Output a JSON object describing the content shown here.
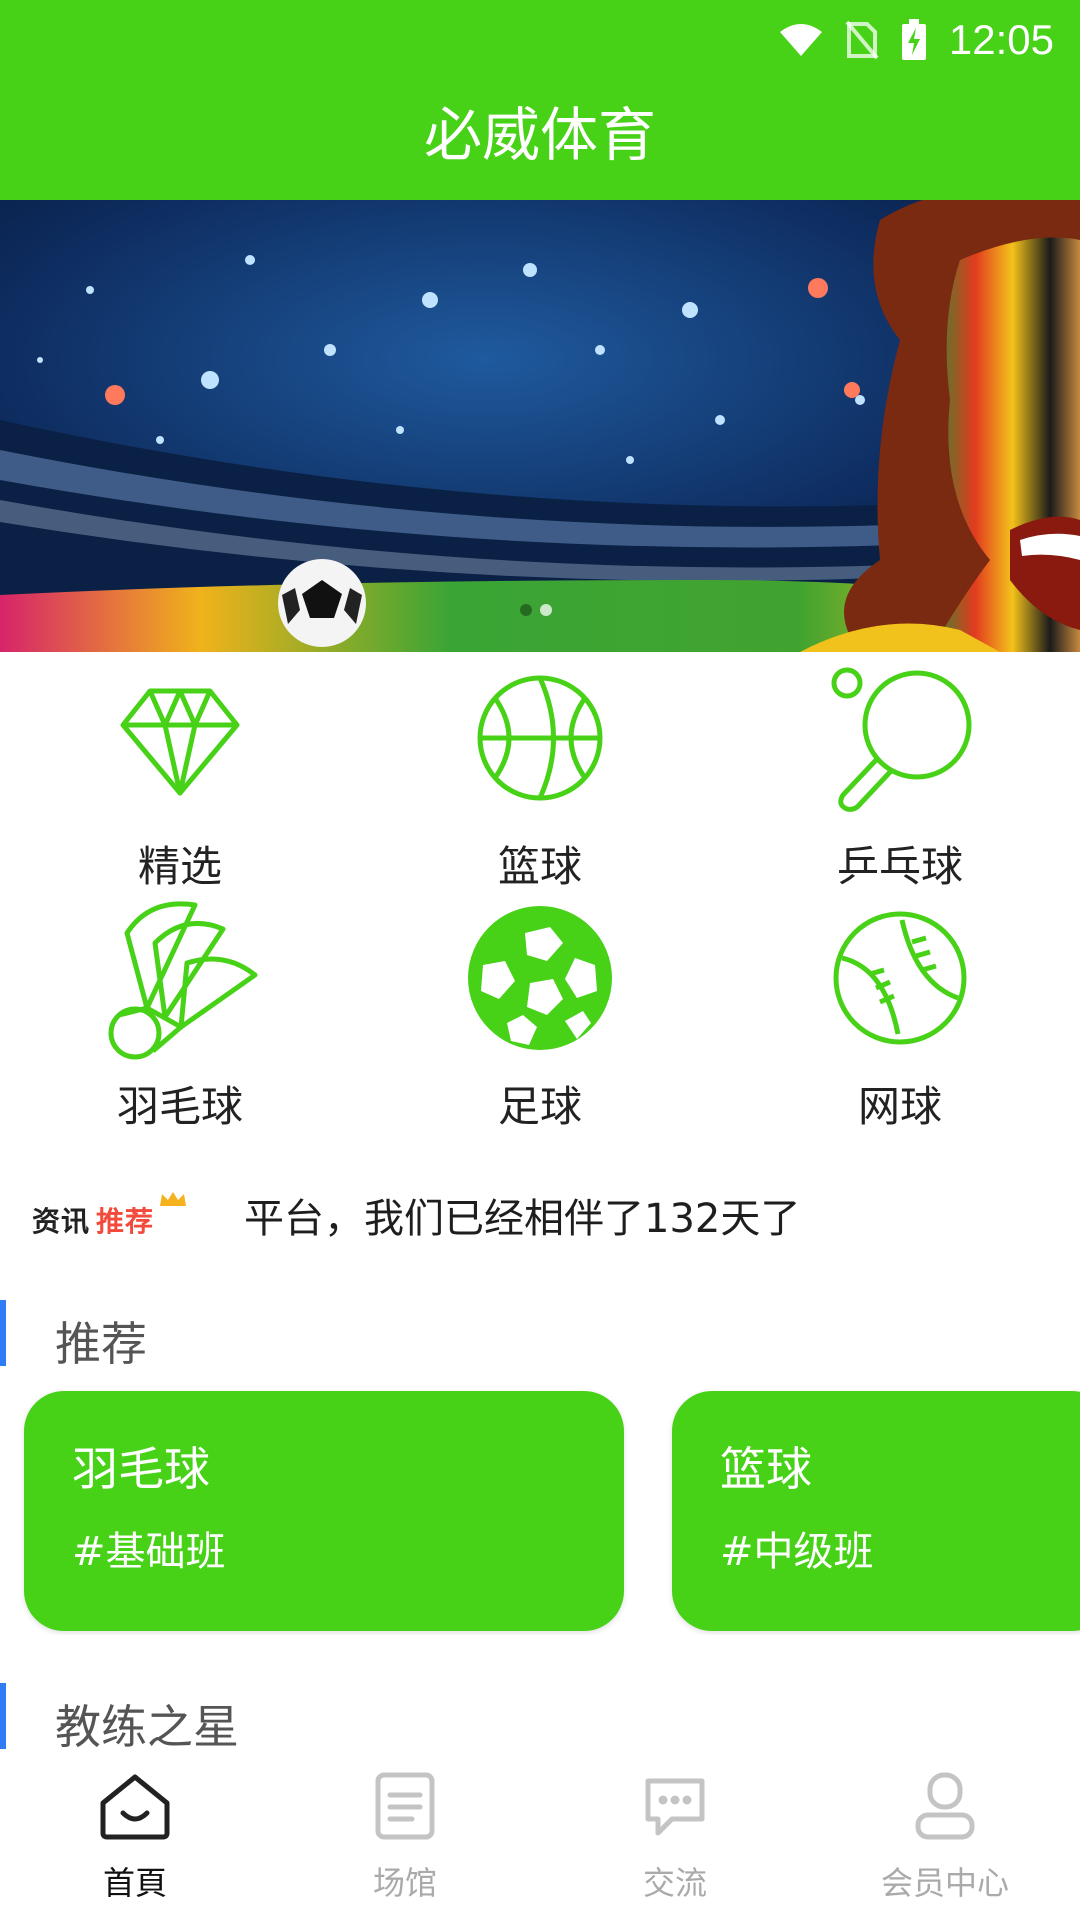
{
  "status_bar": {
    "time": "12:05"
  },
  "header": {
    "title": "必威体育"
  },
  "banner": {
    "page_count": 2,
    "active_index": 1
  },
  "categories": [
    {
      "label": "精选",
      "icon": "diamond-icon"
    },
    {
      "label": "篮球",
      "icon": "basketball-icon"
    },
    {
      "label": "乒乓球",
      "icon": "ping-pong-paddle-icon"
    },
    {
      "label": "羽毛球",
      "icon": "shuttlecock-icon"
    },
    {
      "label": "足球",
      "icon": "soccer-ball-icon"
    },
    {
      "label": "网球",
      "icon": "baseball-icon"
    }
  ],
  "news": {
    "logo_part1": "资讯",
    "logo_part2": "推荐",
    "ticker_text": "平台，我们已经相伴了132天了"
  },
  "sections": {
    "recommend": "推荐",
    "coach_star": "教练之星"
  },
  "cards": [
    {
      "name": "羽毛球",
      "tag": "#基础班"
    },
    {
      "name": "篮球",
      "tag": "#中级班"
    }
  ],
  "bottom_nav": [
    {
      "label": "首頁",
      "icon": "home-icon",
      "active": true
    },
    {
      "label": "场馆",
      "icon": "document-icon",
      "active": false
    },
    {
      "label": "交流",
      "icon": "chat-icon",
      "active": false
    },
    {
      "label": "会员中心",
      "icon": "user-icon",
      "active": false
    }
  ],
  "colors": {
    "primary": "#47d117",
    "section_accent": "#2f7df6",
    "news_accent": "#f24a3b"
  }
}
